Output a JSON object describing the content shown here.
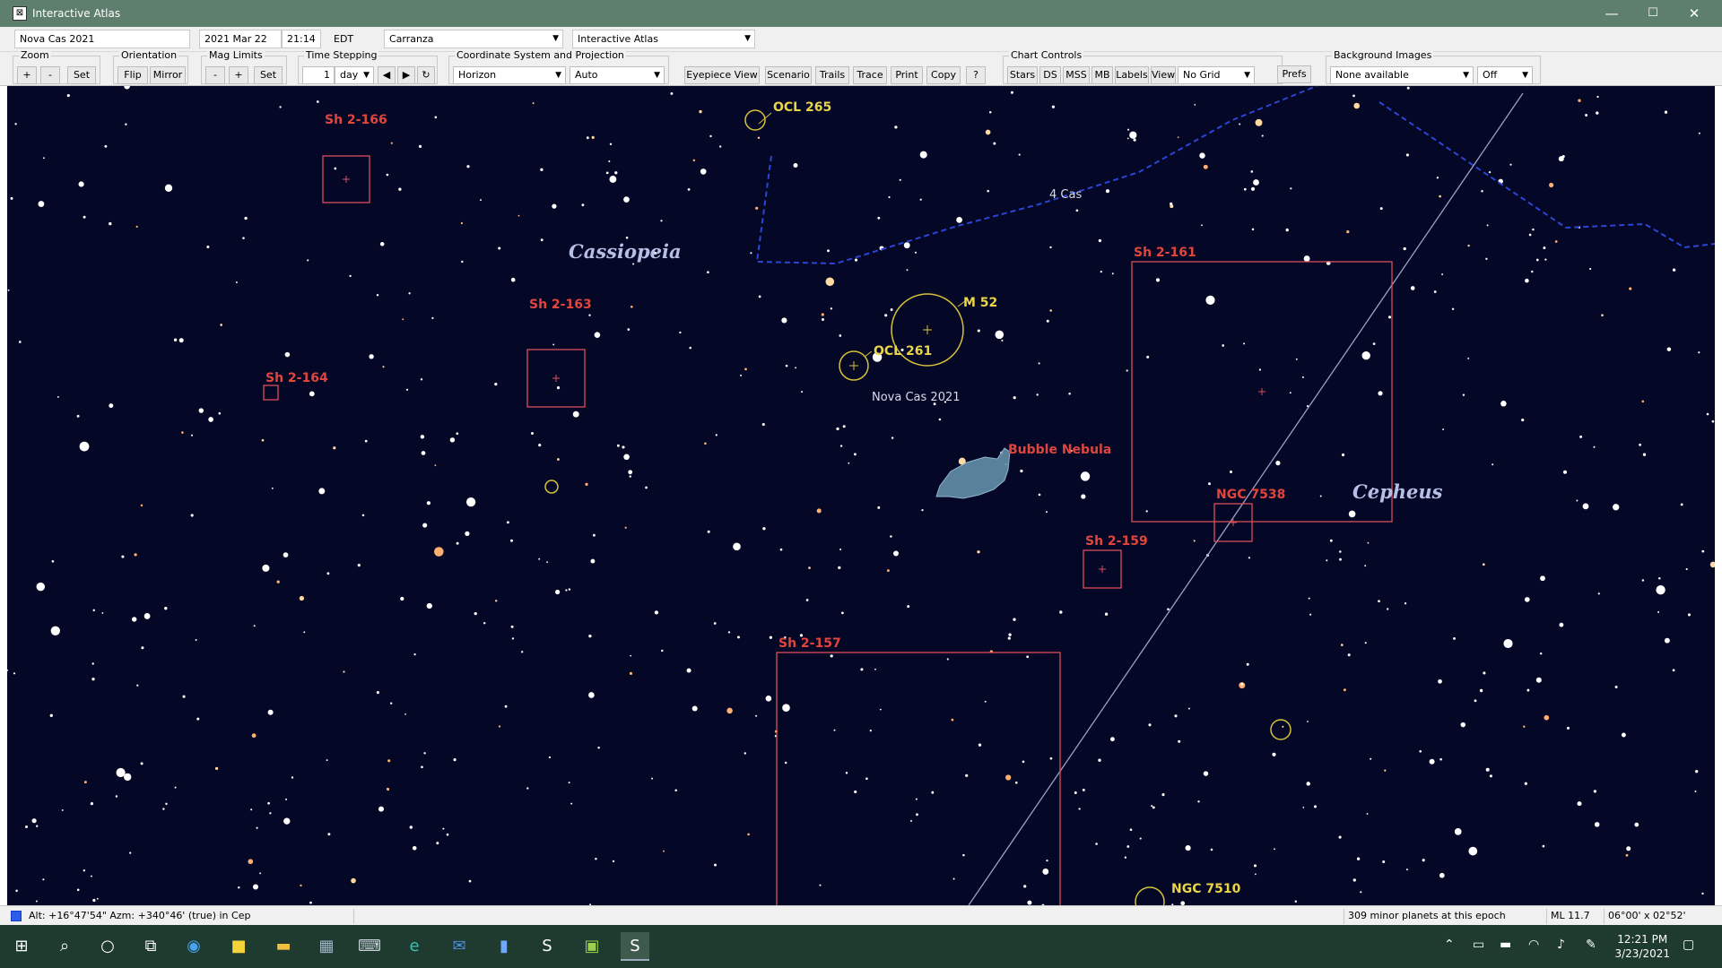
{
  "window": {
    "title": "Interactive Atlas",
    "minimize": "—",
    "maximize": "☐",
    "close": "✕"
  },
  "bar1": {
    "object_name": "Nova Cas 2021",
    "date": "2021 Mar 22",
    "time": "21:14",
    "timezone": "EDT",
    "site": "Carranza",
    "chart_type": "Interactive Atlas"
  },
  "toolbar": {
    "zoom": {
      "label": "Zoom",
      "plus": "+",
      "minus": "-",
      "set": "Set"
    },
    "orientation": {
      "label": "Orientation",
      "flip": "Flip",
      "mirror": "Mirror"
    },
    "mag_limits": {
      "label": "Mag Limits",
      "minus": "-",
      "plus": "+",
      "set": "Set"
    },
    "time_stepping": {
      "label": "Time Stepping",
      "step": "1",
      "unit": "day",
      "back": "◀",
      "forward": "▶",
      "reset": "↻"
    },
    "coords": {
      "label": "Coordinate System and Projection",
      "system": "Horizon",
      "projection": "Auto"
    },
    "actions": {
      "eyepiece": "Eyepiece View",
      "scenario": "Scenario",
      "trails": "Trails",
      "trace": "Trace",
      "print": "Print",
      "copy": "Copy",
      "help": "?"
    },
    "chart_controls": {
      "label": "Chart Controls",
      "stars": "Stars",
      "ds": "DS",
      "mss": "MSS",
      "mb": "MB",
      "labels": "Labels",
      "view": "View",
      "grid": "No Grid",
      "prefs": "Prefs"
    },
    "background": {
      "label": "Background Images",
      "images": "None available",
      "state": "Off"
    }
  },
  "chart": {
    "constellations": [
      "Cassiopeia",
      "Cepheus"
    ],
    "objects": {
      "sh2_166": "Sh 2-166",
      "sh2_163": "Sh 2-163",
      "sh2_164": "Sh 2-164",
      "sh2_161": "Sh 2-161",
      "sh2_159": "Sh 2-159",
      "sh2_157": "Sh 2-157",
      "ngc7538": "NGC 7538",
      "ngc7510": "NGC 7510",
      "ocl265": "OCL 265",
      "ocl261": "OCL 261",
      "m52": "M 52",
      "bubble": "Bubble Nebula",
      "nova": "Nova Cas 2021",
      "star4cas": "4 Cas"
    },
    "colors": {
      "background": "#050726",
      "nebula_box": "#d9505a",
      "cluster": "#d6c23a",
      "boundary": "#2b45d6",
      "ecliptic": "#9aa0c8",
      "bubble_fill": "#6a97b0"
    }
  },
  "status": {
    "position": "Alt: +16°47'54\"  Azm: +340°46' (true) in Cep",
    "minor_planets": "309 minor planets at this epoch",
    "mag_limit": "ML 11.7",
    "fov": "06°00' x 02°52'"
  },
  "taskbar": {
    "time": "12:21 PM",
    "date": "3/23/2021",
    "icons": [
      "start-icon",
      "search-icon",
      "cortana-icon",
      "task-view-icon",
      "safari-icon",
      "sticky-notes-icon",
      "file-explorer-icon",
      "calculator-icon",
      "keyboard-icon",
      "edge-icon",
      "mail-icon",
      "terminal-icon",
      "skytools3-icon",
      "image-icon",
      "skytools4-icon"
    ]
  }
}
